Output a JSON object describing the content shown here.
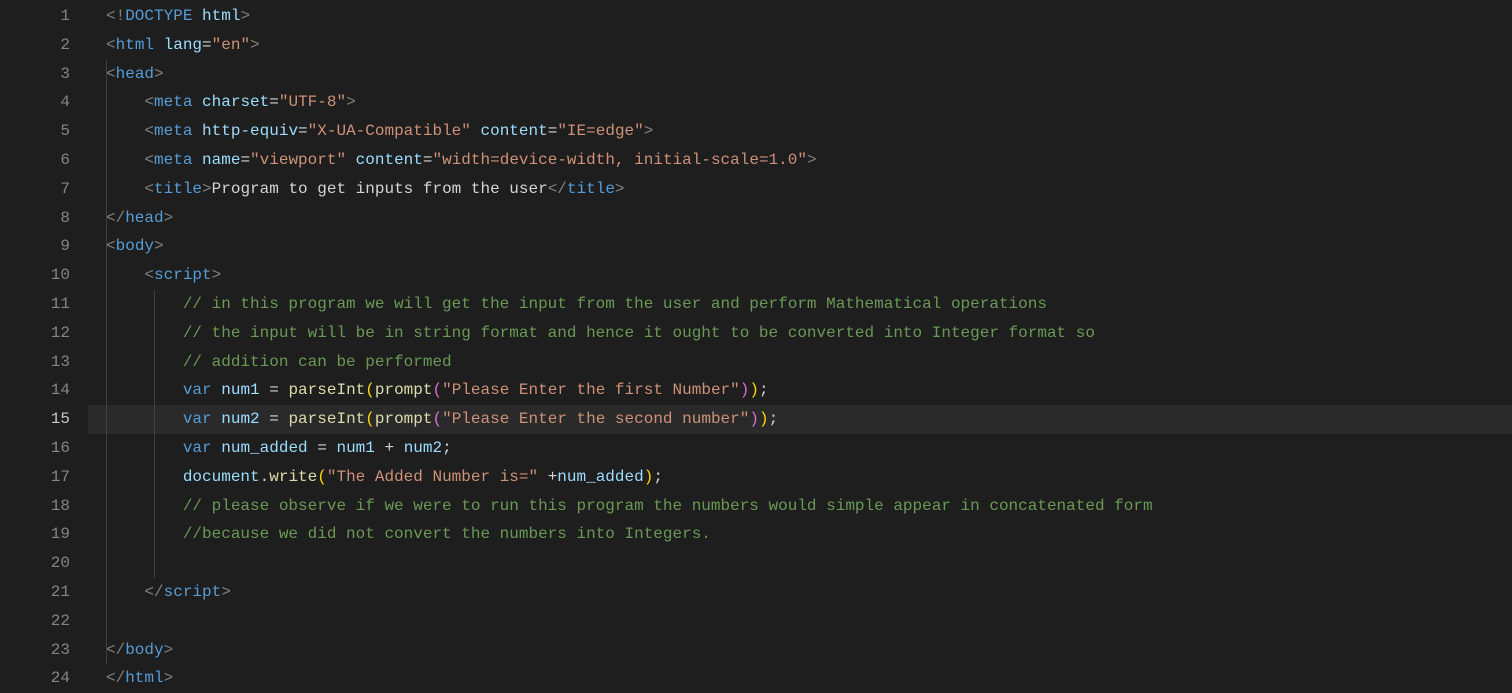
{
  "active_line": 15,
  "tokens": {
    "l1": {
      "t1": "<!",
      "t2": "DOCTYPE",
      "t3": " ",
      "t4": "html",
      "t5": ">"
    },
    "l2": {
      "t1": "<",
      "t2": "html",
      "t3": " ",
      "t4": "lang",
      "t5": "=",
      "t6": "\"en\"",
      "t7": ">"
    },
    "l3": {
      "t1": "<",
      "t2": "head",
      "t3": ">"
    },
    "l4": {
      "t1": "<",
      "t2": "meta",
      "t3": " ",
      "t4": "charset",
      "t5": "=",
      "t6": "\"UTF-8\"",
      "t7": ">"
    },
    "l5": {
      "t1": "<",
      "t2": "meta",
      "t3": " ",
      "t4": "http-equiv",
      "t5": "=",
      "t6": "\"X-UA-Compatible\"",
      "t7": " ",
      "t8": "content",
      "t9": "=",
      "t10": "\"IE=edge\"",
      "t11": ">"
    },
    "l6": {
      "t1": "<",
      "t2": "meta",
      "t3": " ",
      "t4": "name",
      "t5": "=",
      "t6": "\"viewport\"",
      "t7": " ",
      "t8": "content",
      "t9": "=",
      "t10": "\"width=device-width, initial-scale=1.0\"",
      "t11": ">"
    },
    "l7": {
      "t1": "<",
      "t2": "title",
      "t3": ">",
      "t4": "Program to get inputs from the user",
      "t5": "</",
      "t6": "title",
      "t7": ">"
    },
    "l8": {
      "t1": "</",
      "t2": "head",
      "t3": ">"
    },
    "l9": {
      "t1": "<",
      "t2": "body",
      "t3": ">"
    },
    "l10": {
      "t1": "<",
      "t2": "script",
      "t3": ">"
    },
    "l11": {
      "t1": "// in this program we will get the input from the user and perform Mathematical operations"
    },
    "l12": {
      "t1": "// the input will be in string format and hence it ought to be converted into Integer format so"
    },
    "l13": {
      "t1": "// addition can be performed"
    },
    "l14": {
      "t1": "var",
      "t2": " ",
      "t3": "num1",
      "t4": " = ",
      "t5": "parseInt",
      "t6": "(",
      "t7": "prompt",
      "t8": "(",
      "t9": "\"Please Enter the first Number\"",
      "t10": ")",
      "t11": ")",
      "t12": ";"
    },
    "l15": {
      "t1": "var",
      "t2": " ",
      "t3": "num2",
      "t4": " = ",
      "t5": "parseInt",
      "t6": "(",
      "t7": "prompt",
      "t8": "(",
      "t9": "\"Please Enter the second number\"",
      "t10": ")",
      "t11": ")",
      "t12": ";"
    },
    "l16": {
      "t1": "var",
      "t2": " ",
      "t3": "num_added",
      "t4": " = ",
      "t5": "num1",
      "t6": " + ",
      "t7": "num2",
      "t8": ";"
    },
    "l17": {
      "t1": "document",
      "t2": ".",
      "t3": "write",
      "t4": "(",
      "t5": "\"The Added Number is=\"",
      "t6": " +",
      "t7": "num_added",
      "t8": ")",
      "t9": ";"
    },
    "l18": {
      "t1": "// please observe if we were to run this program the numbers would simple appear in concatenated form"
    },
    "l19": {
      "t1": "//because we did not convert the numbers into Integers."
    },
    "l21": {
      "t1": "</",
      "t2": "script",
      "t3": ">"
    },
    "l23": {
      "t1": "</",
      "t2": "body",
      "t3": ">"
    },
    "l24": {
      "t1": "</",
      "t2": "html",
      "t3": ">"
    }
  },
  "line_numbers": [
    "1",
    "2",
    "3",
    "4",
    "5",
    "6",
    "7",
    "8",
    "9",
    "10",
    "11",
    "12",
    "13",
    "14",
    "15",
    "16",
    "17",
    "18",
    "19",
    "20",
    "21",
    "22",
    "23",
    "24"
  ]
}
